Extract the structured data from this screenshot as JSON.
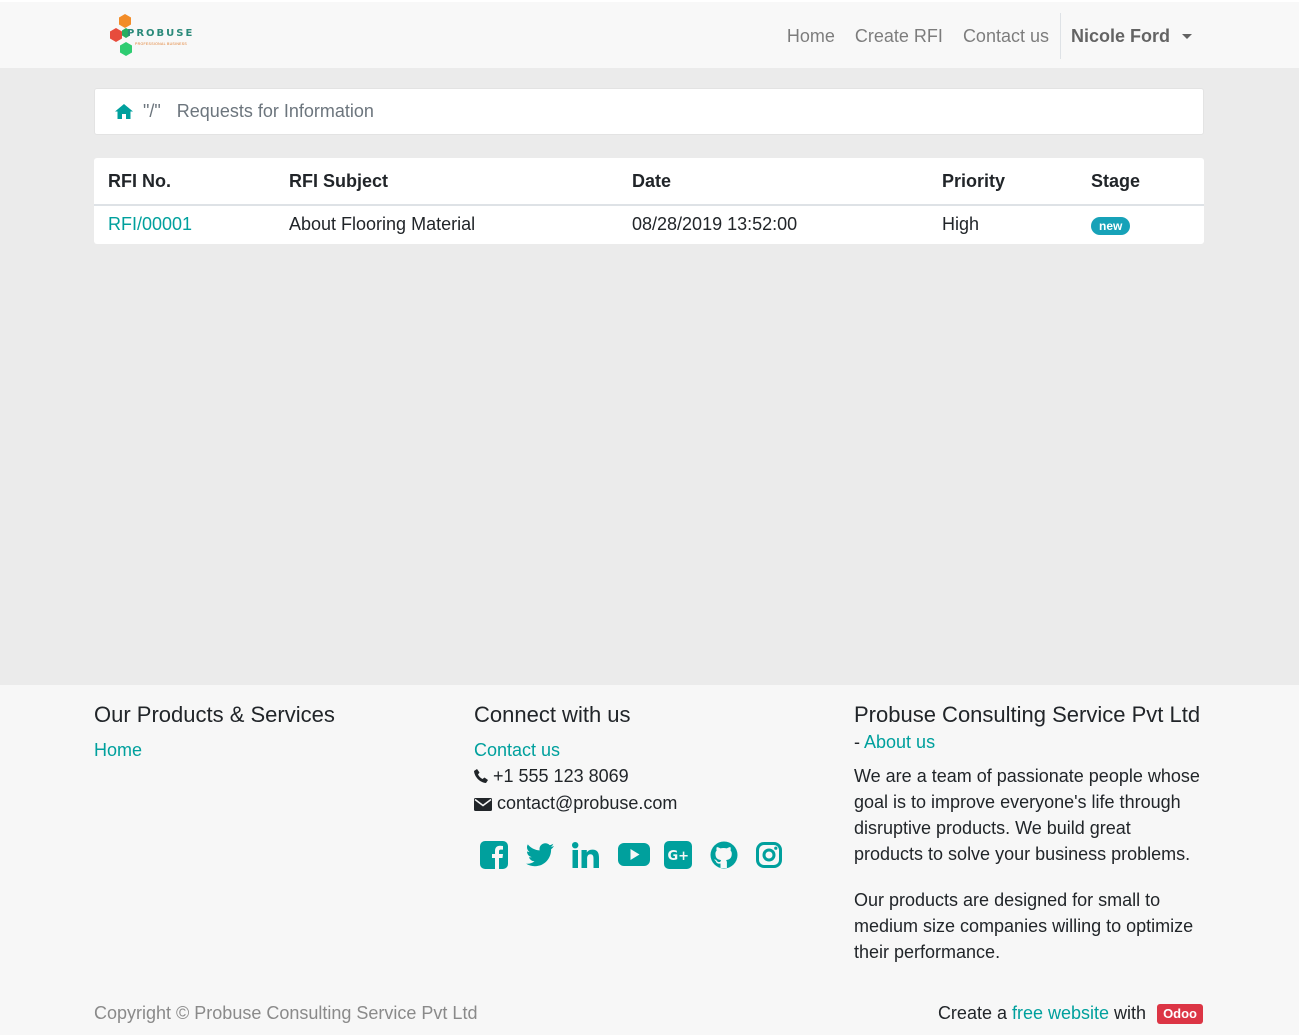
{
  "header": {
    "logo_text": "PROBUSE",
    "logo_subtext": "PROFESSIONAL BUSINESS",
    "nav": [
      {
        "label": "Home"
      },
      {
        "label": "Create RFI"
      },
      {
        "label": "Contact us"
      }
    ],
    "user_name": "Nicole Ford"
  },
  "breadcrumb": {
    "separator": "\"/\"",
    "current": "Requests for Information"
  },
  "table": {
    "columns": [
      "RFI No.",
      "RFI Subject",
      "Date",
      "Priority",
      "Stage"
    ],
    "rows": [
      {
        "rfi_no": "RFI/00001",
        "subject": "About Flooring Material",
        "date": "08/28/2019 13:52:00",
        "priority": "High",
        "stage": "new"
      }
    ]
  },
  "footer": {
    "products": {
      "title": "Our Products & Services",
      "home_link": "Home"
    },
    "connect": {
      "title": "Connect with us",
      "contact_link": "Contact us",
      "phone": "+1 555 123 8069",
      "email": "contact@probuse.com",
      "social_icons": [
        "facebook-icon",
        "twitter-icon",
        "linkedin-icon",
        "youtube-icon",
        "google-plus-icon",
        "github-icon",
        "instagram-icon"
      ]
    },
    "company": {
      "title": "Probuse Consulting Service Pvt Ltd",
      "dash": "- ",
      "about_link": "About us",
      "para1": "We are a team of passionate people whose goal is to improve everyone's life through disruptive products. We build great products to solve your business problems.",
      "para2": "Our products are designed for small to medium size companies willing to optimize their performance."
    },
    "copyright": "Copyright © Probuse Consulting Service Pvt Ltd",
    "powered": {
      "prefix": "Create a ",
      "link": "free website",
      "mid": " with ",
      "badge": "Odoo"
    }
  },
  "colors": {
    "accent": "#00a09d",
    "badge_info": "#17a2b8",
    "odoo_badge": "#dc3545"
  }
}
